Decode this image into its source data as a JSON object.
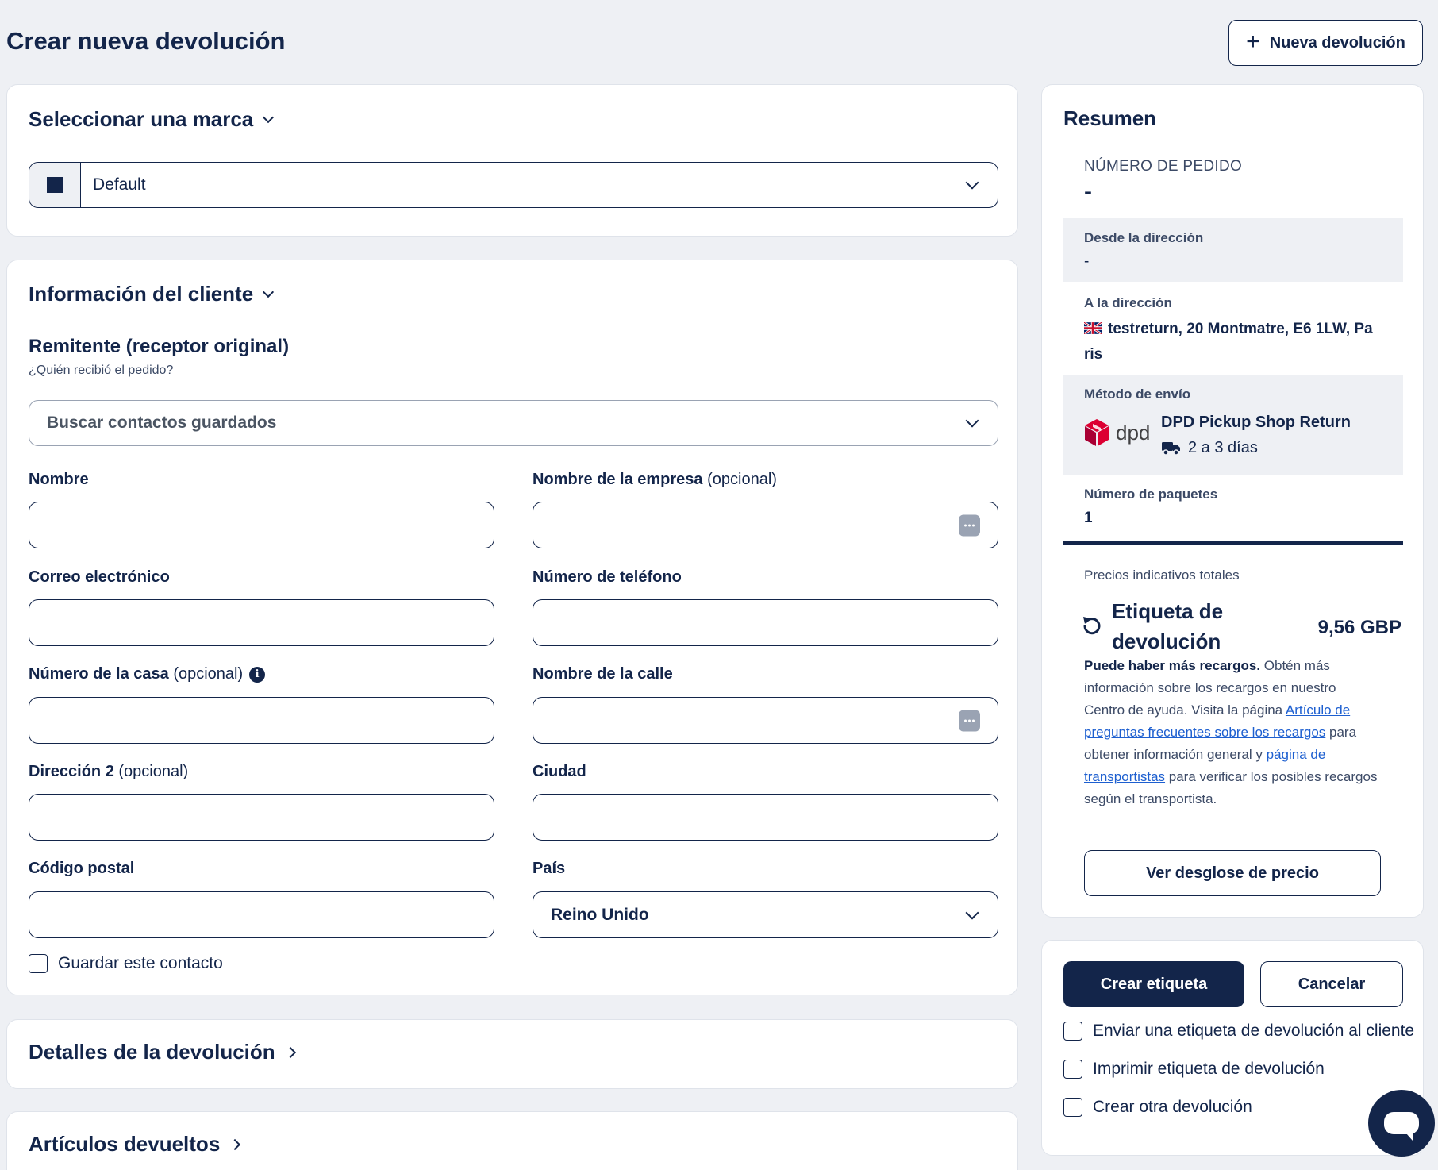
{
  "header": {
    "title": "Crear nueva devolución",
    "new_button_label": "Nueva devolución"
  },
  "brand": {
    "title": "Seleccionar una marca",
    "selected": "Default",
    "swatch_color": "#13254a"
  },
  "customer": {
    "title": "Información del cliente",
    "sender_heading": "Remitente (receptor original)",
    "sender_hint": "¿Quién recibió el pedido?",
    "search_placeholder": "Buscar contactos guardados",
    "fields": {
      "name": {
        "label": "Nombre",
        "value": ""
      },
      "company": {
        "label": "Nombre de la empresa",
        "optional": "(opcional)",
        "value": ""
      },
      "email": {
        "label": "Correo electrónico",
        "value": ""
      },
      "phone": {
        "label": "Número de teléfono",
        "value": ""
      },
      "house_number": {
        "label": "Número de la casa",
        "optional": "(opcional)",
        "value": ""
      },
      "street": {
        "label": "Nombre de la calle",
        "value": ""
      },
      "address2": {
        "label": "Dirección 2",
        "optional": "(opcional)",
        "value": ""
      },
      "city": {
        "label": "Ciudad",
        "value": ""
      },
      "postal_code": {
        "label": "Código postal",
        "value": ""
      },
      "country": {
        "label": "País",
        "value": "Reino Unido"
      }
    },
    "save_contact_label": "Guardar este contacto"
  },
  "sections": {
    "return_details": "Detalles de la devolución",
    "returned_items": "Artículos devueltos"
  },
  "summary": {
    "title": "Resumen",
    "order_number_label": "NÚMERO DE PEDIDO",
    "order_number_value": "-",
    "from_address_label": "Desde la dirección",
    "from_address_value": "-",
    "to_address_label": "A la dirección",
    "to_address_line1": "testreturn, 20 Montmatre, E6 1LW, Pa",
    "to_address_line2": "ris",
    "shipping_method_label": "Método de envío",
    "carrier_logo_text": "dpd",
    "carrier_name": "DPD Pickup Shop Return",
    "carrier_time": "2 a 3 días",
    "packages_label": "Número de paquetes",
    "packages_value": "1",
    "prices_label": "Precios indicativos totales",
    "price_item_line1": "Etiqueta de",
    "price_item_line2": "devolución",
    "price_amount": "9,56 GBP",
    "surcharge_bold": "Puede haber más recargos.",
    "surcharge_text1": " Obtén más información sobre los recargos en nuestro Centro de ayuda. Visita la página ",
    "surcharge_link1": "Artículo de preguntas frecuentes sobre los recargos",
    "surcharge_text2": " para obtener información general y ",
    "surcharge_link2": "página de transportistas",
    "surcharge_text3": " para verificar los posibles recargos según el transportista.",
    "breakdown_button": "Ver desglose de precio"
  },
  "actions": {
    "create_label": "Crear etiqueta",
    "cancel": "Cancelar",
    "options": [
      {
        "label": "Enviar una etiqueta de devolución al cliente",
        "checked": false
      },
      {
        "label": "Imprimir etiqueta de devolución",
        "checked": false
      },
      {
        "label": "Crear otra devolución",
        "checked": false
      }
    ]
  },
  "colors": {
    "navy": "#13254a",
    "background": "#eef0f4",
    "dpd_red": "#dc0032",
    "link": "#1d5fd0"
  }
}
